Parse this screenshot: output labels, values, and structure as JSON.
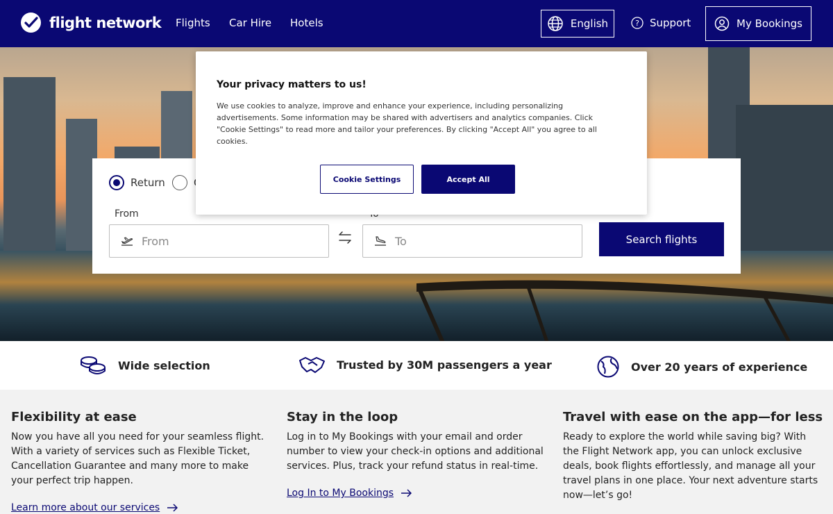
{
  "nav": {
    "logo_text": "flight network",
    "links": [
      "Flights",
      "Car Hire",
      "Hotels"
    ],
    "language": "English",
    "support": "Support",
    "bookings": "My Bookings"
  },
  "search": {
    "trip_types": [
      "Return",
      "O"
    ],
    "from_label": "From",
    "from_placeholder": "From",
    "to_label": "To",
    "to_placeholder": "To",
    "button": "Search flights"
  },
  "cookie": {
    "title": "Your privacy matters to us!",
    "body": "We use cookies to analyze, improve and enhance your experience, including personalizing advertisements. Some information may be shared with advertisers and analytics companies. Click \"Cookie Settings\" to read more and tailor your preferences. By clicking \"Accept All\" you agree to all cookies.",
    "settings_button": "Cookie Settings",
    "accept_button": "Accept All"
  },
  "features": [
    "Wide selection",
    "Trusted by 30M passengers a year",
    "Over 20 years of experience"
  ],
  "info": [
    {
      "title": "Flexibility at ease",
      "body": "Now you have all you need for your seamless flight. With a variety of services such as Flexible Ticket, Cancellation Guarantee and many more to make your perfect trip happen.",
      "link": "Learn more about our services"
    },
    {
      "title": "Stay in the loop",
      "body": "Log in to My Bookings with your email and order number to view your check-in options and additional services. Plus, track your refund status in real-time.",
      "link": "Log In to My Bookings"
    },
    {
      "title": "Travel with ease on the app—for less",
      "body": "Ready to explore the world while saving big? With the Flight Network app, you can unlock exclusive deals, book flights effortlessly, and manage all your travel plans in one place. Your next adventure starts now—let’s go!"
    }
  ],
  "colors": {
    "brand": "#0a0873",
    "background": "#f2f2f2"
  }
}
